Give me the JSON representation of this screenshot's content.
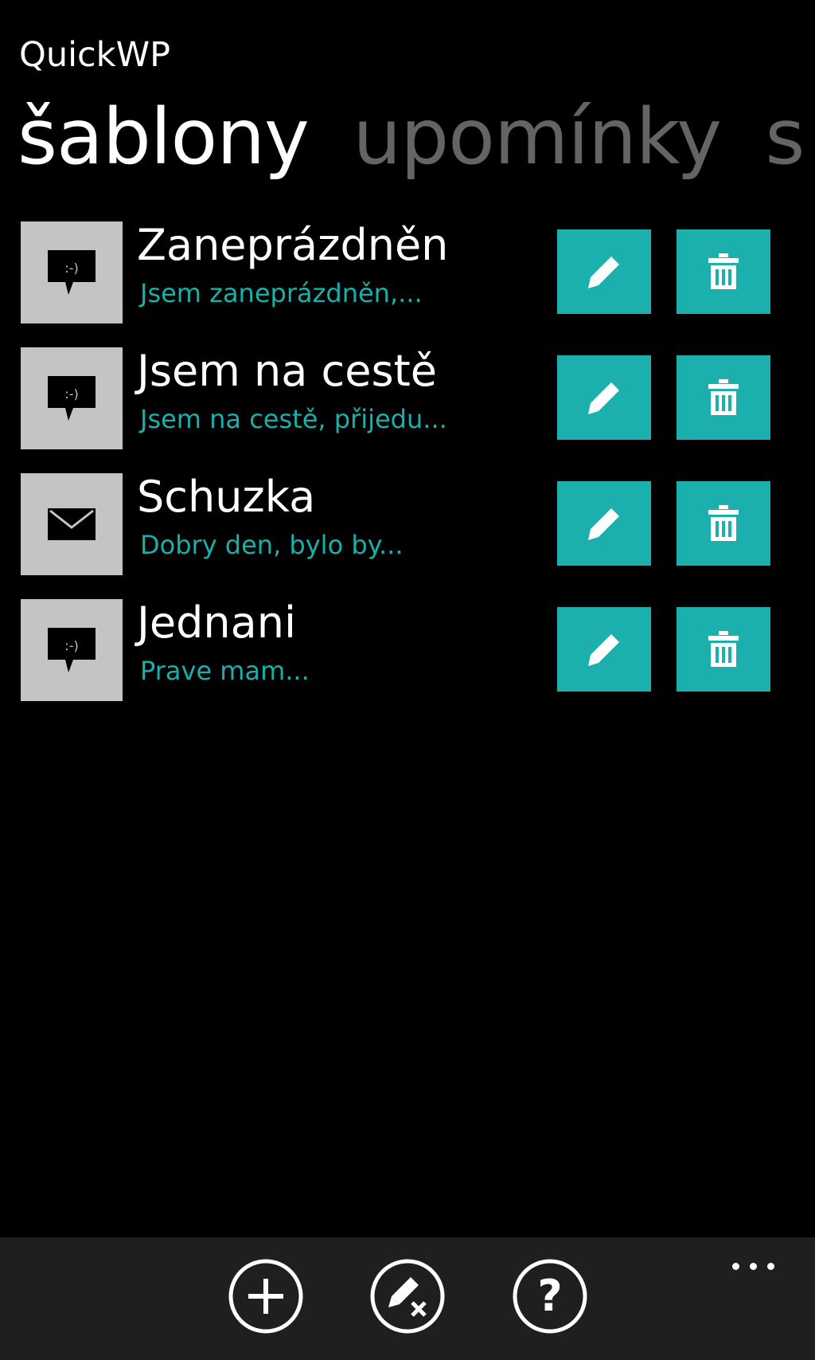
{
  "app": {
    "title": "QuickWP"
  },
  "pivot": {
    "items": [
      {
        "label": "šablony",
        "active": true
      },
      {
        "label": "upomínky",
        "active": false
      },
      {
        "label": "s",
        "active": false
      }
    ]
  },
  "templates": [
    {
      "title": "Zaneprázdněn",
      "preview": "Jsem zaneprázdněn,...",
      "icon": "sms-bubble-icon"
    },
    {
      "title": "Jsem na cestě",
      "preview": "Jsem na cestě, přijedu...",
      "icon": "sms-bubble-icon"
    },
    {
      "title": "Schuzka",
      "preview": "Dobry den, bylo by...",
      "icon": "envelope-icon"
    },
    {
      "title": "Jednani",
      "preview": "Prave mam...",
      "icon": "sms-bubble-icon"
    }
  ],
  "row_actions": {
    "edit_icon": "pencil-icon",
    "delete_icon": "trash-icon"
  },
  "app_bar": {
    "buttons": [
      {
        "icon": "add-icon"
      },
      {
        "icon": "edit-mode-icon"
      },
      {
        "icon": "help-icon"
      }
    ],
    "more": "..."
  },
  "colors": {
    "background": "#000000",
    "accent": "#1bb0ae",
    "preview_text": "#17b0ac",
    "icon_tile": "#c4c4c4",
    "inactive_pivot": "#646464",
    "app_bar": "#1f1f1f"
  }
}
